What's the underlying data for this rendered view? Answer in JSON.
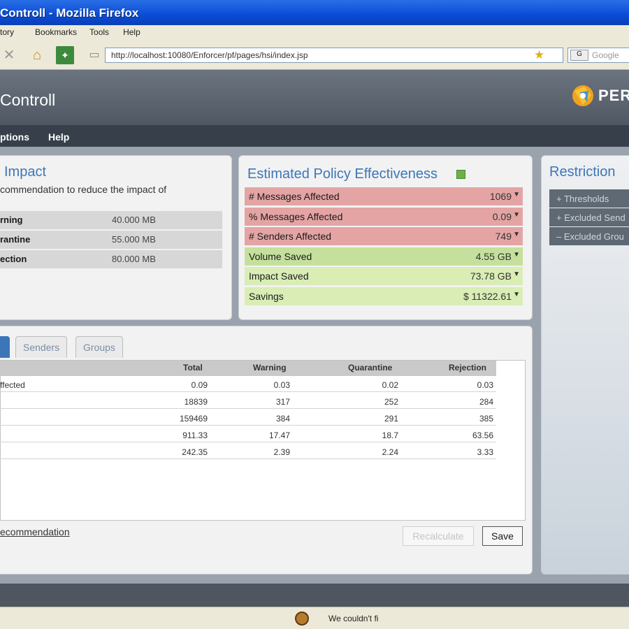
{
  "browser": {
    "title": "Controll - Mozilla Firefox",
    "menu": [
      "tory",
      "Bookmarks",
      "Tools",
      "Help"
    ],
    "url": "http://localhost:10080/Enforcer/pf/pages/hsi/index.jsp",
    "search_placeholder": "Google"
  },
  "app": {
    "title": "Controll",
    "logo_text": "PER",
    "nav": [
      "ptions",
      "Help"
    ]
  },
  "impact": {
    "title": "Impact",
    "description": "commendation to reduce the impact of",
    "rows": [
      {
        "label": "rning",
        "value": "40.000 MB"
      },
      {
        "label": "rantine",
        "value": "55.000 MB"
      },
      {
        "label": "ection",
        "value": "80.000 MB"
      }
    ]
  },
  "effectiveness": {
    "title": "Estimated Policy Effectiveness",
    "rows": [
      {
        "label": "# Messages Affected",
        "value": "1069",
        "status": "bad"
      },
      {
        "label": "% Messages Affected",
        "value": "0.09",
        "status": "bad"
      },
      {
        "label": "# Senders Affected",
        "value": "749",
        "status": "bad"
      },
      {
        "label": "Volume Saved",
        "value": "4.55 GB",
        "status": "good"
      },
      {
        "label": "Impact Saved",
        "value": "73.78 GB",
        "status": "good"
      },
      {
        "label": "Savings",
        "value": "$ 11322.61",
        "status": "good"
      }
    ]
  },
  "restriction": {
    "title": "Restriction",
    "items": [
      "Thresholds",
      "Excluded Send",
      "Excluded Grou"
    ]
  },
  "tabs": [
    "Senders",
    "Groups"
  ],
  "table": {
    "headers": [
      "Total",
      "Warning",
      "Quarantine",
      "Rejection"
    ],
    "rows": [
      {
        "label": "ffected",
        "total": "0.09",
        "warning": "0.03",
        "quarantine": "0.02",
        "rejection": "0.03"
      },
      {
        "label": "",
        "total": "18839",
        "warning": "317",
        "quarantine": "252",
        "rejection": "284"
      },
      {
        "label": "",
        "total": "159469",
        "warning": "384",
        "quarantine": "291",
        "rejection": "385"
      },
      {
        "label": "",
        "total": "911.33",
        "warning": "17.47",
        "quarantine": "18.7",
        "rejection": "63.56"
      },
      {
        "label": "",
        "total": "242.35",
        "warning": "2.39",
        "quarantine": "2.24",
        "rejection": "3.33"
      }
    ]
  },
  "footer": {
    "link": "ecommendation",
    "recalculate": "Recalculate",
    "save": "Save"
  },
  "status_text": "We couldn't fi"
}
